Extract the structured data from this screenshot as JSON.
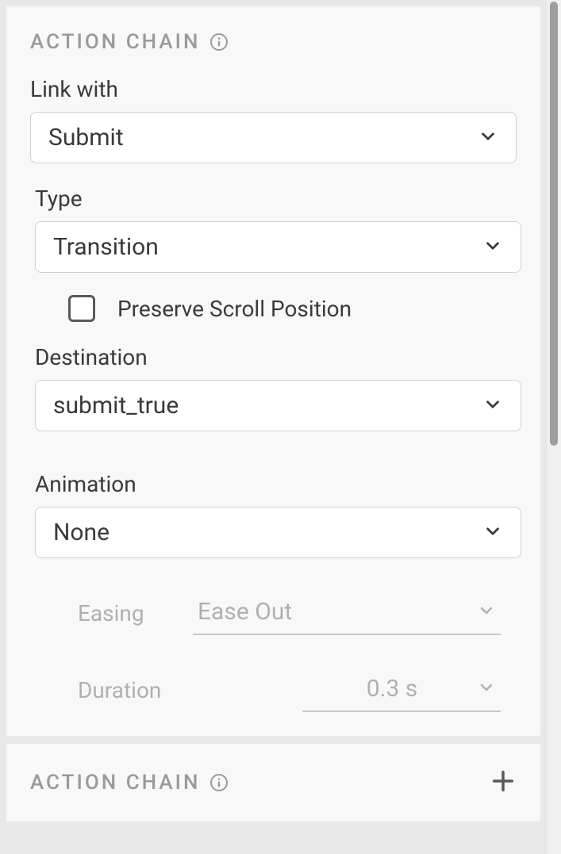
{
  "panel1": {
    "title": "ACTION CHAIN",
    "linkWith": {
      "label": "Link with",
      "value": "Submit"
    },
    "type": {
      "label": "Type",
      "value": "Transition"
    },
    "preserveScroll": {
      "label": "Preserve Scroll Position",
      "checked": false
    },
    "destination": {
      "label": "Destination",
      "value": "submit_true"
    },
    "animation": {
      "label": "Animation",
      "value": "None"
    },
    "easing": {
      "label": "Easing",
      "value": "Ease Out"
    },
    "duration": {
      "label": "Duration",
      "value": "0.3 s"
    }
  },
  "panel2": {
    "title": "ACTION CHAIN"
  }
}
